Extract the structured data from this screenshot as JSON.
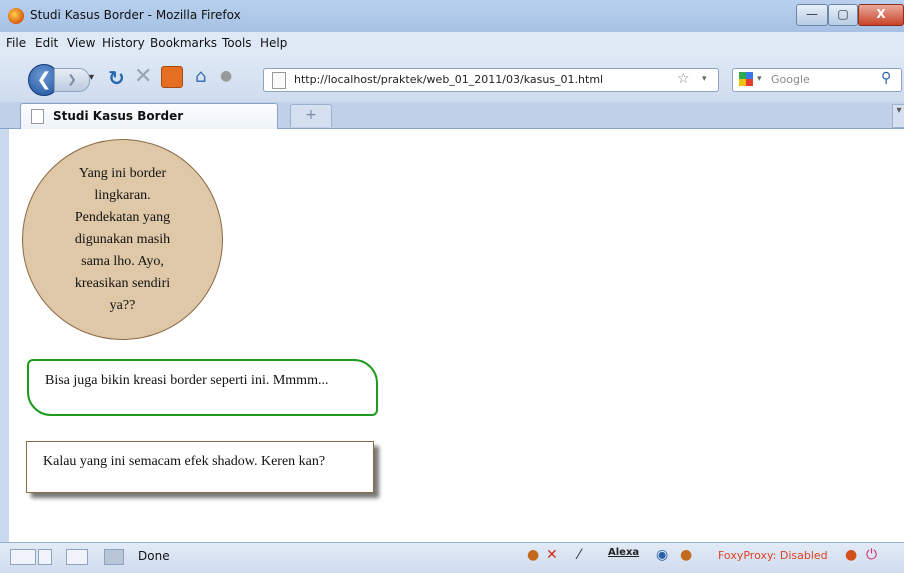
{
  "window": {
    "title": "Studi Kasus Border - Mozilla Firefox",
    "controls": {
      "minimize": "—",
      "maximize": "▢",
      "close": "X"
    }
  },
  "menu": [
    "File",
    "Edit",
    "View",
    "History",
    "Bookmarks",
    "Tools",
    "Help"
  ],
  "nav": {
    "url": "http://localhost/praktek/web_01_2011/03/kasus_01.html",
    "search_placeholder": "Google"
  },
  "tab": {
    "label": "Studi Kasus Border",
    "new_tab": "+"
  },
  "content": {
    "circle_text": "Yang ini border lingkaran. Pendekatan yang digunakan masih sama lho. Ayo, kreasikan sendiri ya??",
    "green_box_text": "Bisa juga bikin kreasi border seperti ini. Mmmm...",
    "shadow_box_text": "Kalau yang ini semacam efek shadow. Keren kan?"
  },
  "status": {
    "text": "Done",
    "alexa": "Alexa",
    "foxyproxy": "FoxyProxy: Disabled"
  },
  "colors": {
    "circle_bg": "#dfc8a7",
    "green_border": "#1e9a1e",
    "foxyproxy": "#e0402a"
  }
}
